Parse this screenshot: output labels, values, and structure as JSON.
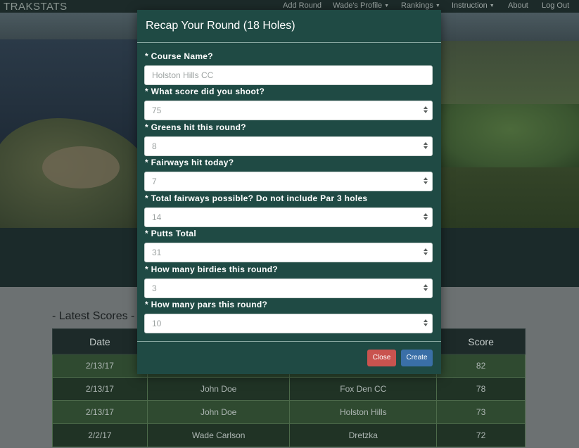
{
  "navbar": {
    "brand": "TRAKSTATS",
    "items": [
      {
        "label": "Add Round",
        "dropdown": false
      },
      {
        "label": "Wade's Profile",
        "dropdown": true
      },
      {
        "label": "Rankings",
        "dropdown": true
      },
      {
        "label": "Instruction",
        "dropdown": true
      },
      {
        "label": "About",
        "dropdown": false
      },
      {
        "label": "Log Out",
        "dropdown": false
      }
    ]
  },
  "latest_scores": {
    "title": "- Latest Scores -",
    "headers": [
      "Date",
      "",
      "",
      "Score"
    ],
    "rows": [
      {
        "date": "2/13/17",
        "name": "",
        "course": "",
        "score": "82"
      },
      {
        "date": "2/13/17",
        "name": "John Doe",
        "course": "Fox Den CC",
        "score": "78"
      },
      {
        "date": "2/13/17",
        "name": "John Doe",
        "course": "Holston Hills",
        "score": "73"
      },
      {
        "date": "2/2/17",
        "name": "Wade Carlson",
        "course": "Dretzka",
        "score": "72"
      }
    ]
  },
  "modal": {
    "title": "Recap Your Round (18 Holes)",
    "fields": [
      {
        "label": "* Course Name?",
        "placeholder": "Holston Hills CC",
        "type": "text"
      },
      {
        "label": "* What score did you shoot?",
        "placeholder": "75",
        "type": "number"
      },
      {
        "label": "* Greens hit this round?",
        "placeholder": "8",
        "type": "number"
      },
      {
        "label": "* Fairways hit today?",
        "placeholder": "7",
        "type": "number"
      },
      {
        "label": "* Total fairways possible? Do not include Par 3 holes",
        "placeholder": "14",
        "type": "number"
      },
      {
        "label": "* Putts Total",
        "placeholder": "31",
        "type": "number"
      },
      {
        "label": "* How many birdies this round?",
        "placeholder": "3",
        "type": "number"
      },
      {
        "label": "* How many pars this round?",
        "placeholder": "10",
        "type": "number"
      }
    ],
    "close_label": "Close",
    "create_label": "Create"
  },
  "colors": {
    "modal_bg": "#1f4a44",
    "close_button": "#c9534f",
    "create_button": "#3a6fa7",
    "navbar_bg": "#1c2a29"
  }
}
